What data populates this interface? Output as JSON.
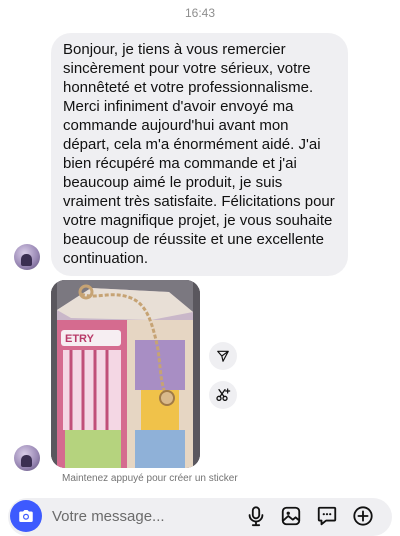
{
  "header": {
    "timestamp": "16:43"
  },
  "message": {
    "text": "Bonjour, je tiens à vous remercier sincèrement pour votre sérieux, votre honnêteté et votre professionnalisme. Merci infiniment d'avoir envoyé ma commande aujourd'hui avant mon départ, cela m'a énormément aidé. J'ai bien récupéré ma commande et j'ai beaucoup aimé le produit, je suis vraiment très satisfaite. Félicitations pour votre magnifique projet, je vous souhaite beaucoup de réussite et une excellente continuation."
  },
  "photo_message": {
    "hint": "Maintenez appuyé pour créer un sticker",
    "photo_text": "ETRY"
  },
  "actions": {
    "send_icon": "paper-plane-icon",
    "cut_icon": "scissors-sparkle-icon"
  },
  "composer": {
    "placeholder": "Votre message...",
    "camera_icon": "camera-icon",
    "tools": [
      "microphone-icon",
      "gallery-icon",
      "sticker-icon",
      "plus-icon"
    ],
    "accent_color": "#3d5afe"
  }
}
